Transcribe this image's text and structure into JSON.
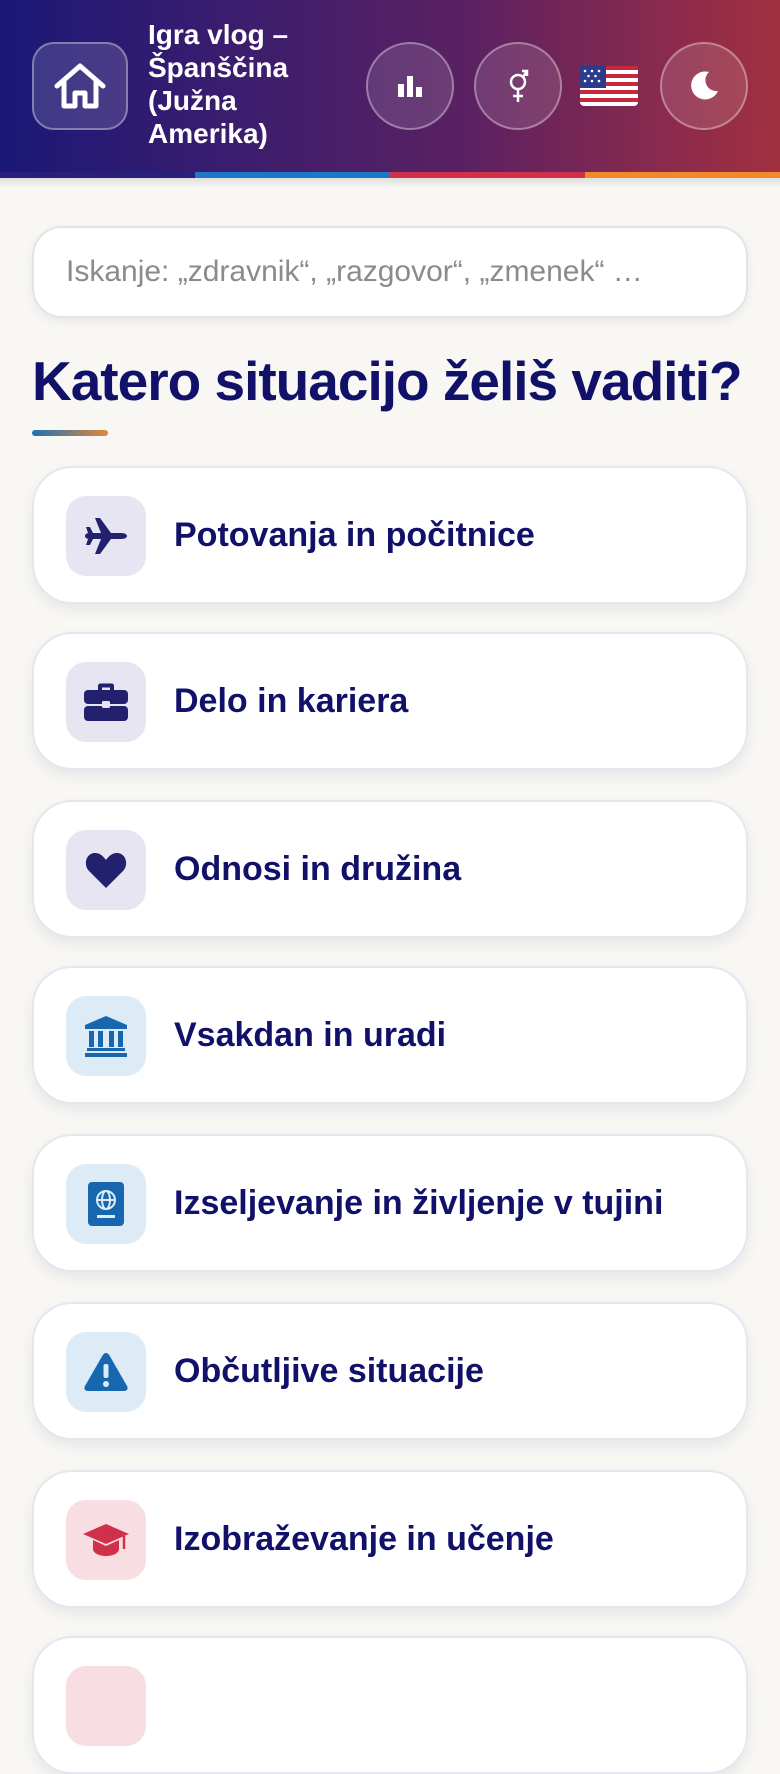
{
  "header": {
    "title": "Igra vlog –\nŠpanščina\n(Južna\nAmerika)",
    "home_icon": "home-icon",
    "stats_icon": "bar-chart-icon",
    "gender_icon": "gender-icon",
    "flag": "🇺🇸",
    "theme_icon": "moon-icon",
    "stripe_colors": [
      "#2a1f7a",
      "#1e78c8",
      "#d0304a",
      "#f08a2c"
    ]
  },
  "search": {
    "placeholder": "Iskanje: „zdravnik“, „razgovor“, „zmenek“ …"
  },
  "main": {
    "heading": "Katero situacijo želiš vaditi?",
    "categories": [
      {
        "label": "Potovanja in počitnice",
        "icon": "airplane-icon"
      },
      {
        "label": "Delo in kariera",
        "icon": "briefcase-icon"
      },
      {
        "label": "Odnosi in družina",
        "icon": "heart-icon"
      },
      {
        "label": "Vsakdan in uradi",
        "icon": "bank-icon"
      },
      {
        "label": "Izseljevanje in življenje v tujini",
        "icon": "passport-icon"
      },
      {
        "label": "Občutljive situacije",
        "icon": "warning-icon"
      },
      {
        "label": "Izobraževanje in učenje",
        "icon": "graduation-cap-icon"
      }
    ]
  },
  "colors": {
    "title": "#12116a",
    "purple_icon": "#23206e",
    "blue_icon": "#1666b0",
    "red_icon": "#d0304a"
  }
}
